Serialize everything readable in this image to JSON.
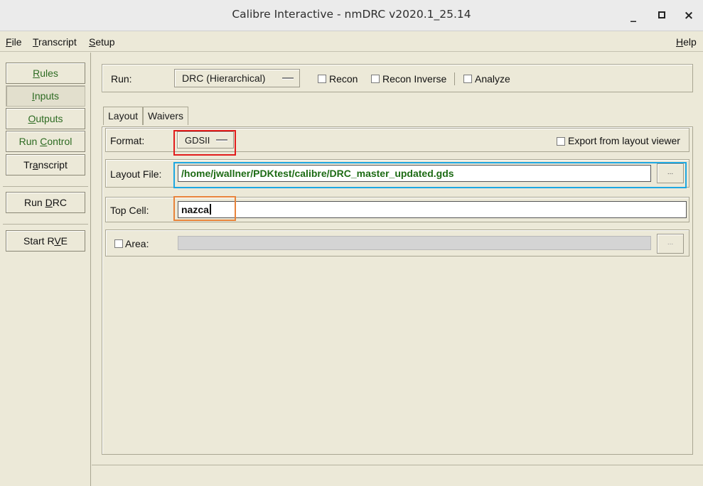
{
  "window": {
    "title": "Calibre Interactive - nmDRC v2020.1_25.14",
    "minimize": "_",
    "close": "×"
  },
  "menubar": {
    "file": {
      "u": "F",
      "rest": "ile"
    },
    "transcript": {
      "u": "T",
      "rest": "ranscript"
    },
    "setup": {
      "u": "S",
      "rest": "etup"
    },
    "help": {
      "u": "H",
      "rest": "elp"
    }
  },
  "sidebar": {
    "rules": {
      "pre": "",
      "u": "R",
      "post": "ules"
    },
    "inputs": {
      "pre": "",
      "u": "I",
      "post": "nputs"
    },
    "outputs": {
      "pre": "",
      "u": "O",
      "post": "utputs"
    },
    "run_control": {
      "pre": "Run ",
      "u": "C",
      "post": "ontrol"
    },
    "transcript": {
      "pre": "Tr",
      "u": "a",
      "post": "nscript"
    },
    "run_drc": {
      "pre": "Run ",
      "u": "D",
      "post": "RC"
    },
    "start_rve": {
      "pre": "Start R",
      "u": "V",
      "post": "E"
    }
  },
  "run": {
    "label": "Run:",
    "mode": "DRC (Hierarchical)",
    "recon": "Recon",
    "recon_inverse": "Recon Inverse",
    "analyze": "Analyze"
  },
  "tabs": {
    "layout": "Layout",
    "waivers": "Waivers"
  },
  "layout": {
    "format_label": "Format:",
    "format_value": "GDSII",
    "export_label": "Export from layout viewer",
    "layout_file_label": "Layout File:",
    "layout_file_value": "/home/jwallner/PDKtest/calibre/DRC_master_updated.gds",
    "browse": "...",
    "top_cell_label": "Top Cell:",
    "top_cell_value": "nazca",
    "area_label": "Area:",
    "area_browse": "..."
  },
  "colors": {
    "highlight_format": "#e21c1c",
    "highlight_layout_file": "#1ea7e1",
    "highlight_top_cell": "#e8833a",
    "accent_text": "#2d6b22"
  }
}
